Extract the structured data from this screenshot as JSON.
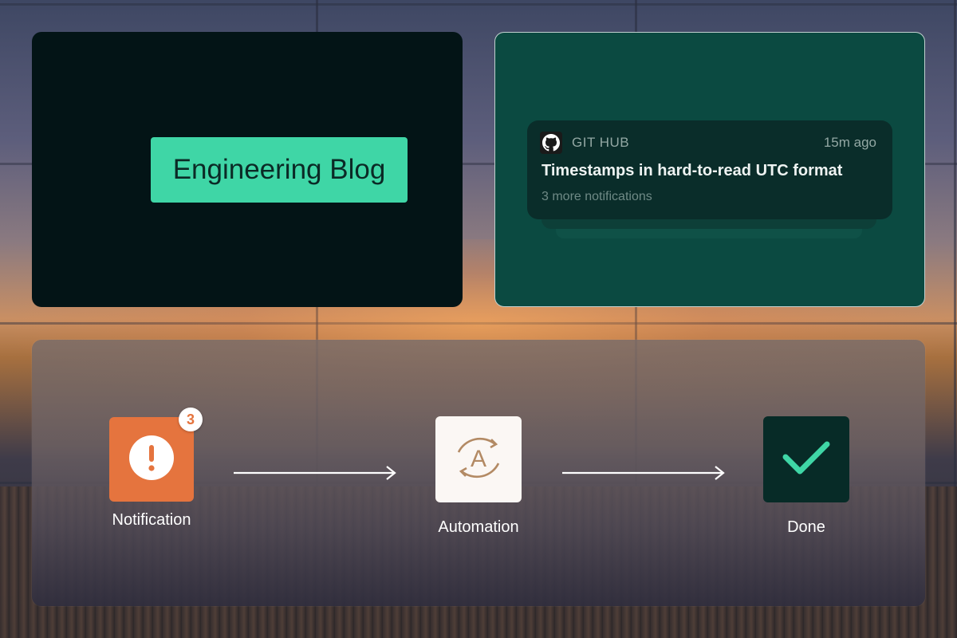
{
  "blog_card": {
    "label": "Engineering Blog",
    "accent": "#3fd6a6"
  },
  "github_card": {
    "source": "GIT HUB",
    "time": "15m ago",
    "title": "Timestamps in hard-to-read UTC format",
    "more": "3 more notifications",
    "icon": "github-icon"
  },
  "flow": {
    "steps": [
      {
        "label": "Notification",
        "icon": "alert-icon",
        "badge": "3",
        "color": "#e5743e"
      },
      {
        "label": "Automation",
        "icon": "automation-icon",
        "color": "#fbf7f4"
      },
      {
        "label": "Done",
        "icon": "checkmark-icon",
        "color": "#072b27"
      }
    ],
    "arrow_icon": "arrow-right-icon"
  }
}
